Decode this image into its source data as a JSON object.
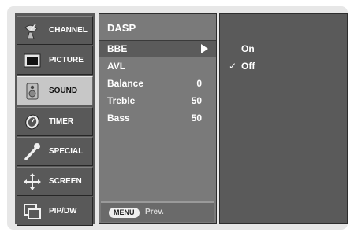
{
  "sidebar": {
    "items": [
      {
        "label": "CHANNEL",
        "icon": "satellite-dish-icon",
        "active": false
      },
      {
        "label": "PICTURE",
        "icon": "tv-screen-icon",
        "active": false
      },
      {
        "label": "SOUND",
        "icon": "speaker-icon",
        "active": true
      },
      {
        "label": "TIMER",
        "icon": "clock-icon",
        "active": false
      },
      {
        "label": "SPECIAL",
        "icon": "wrench-icon",
        "active": false
      },
      {
        "label": "SCREEN",
        "icon": "move-arrows-icon",
        "active": false
      },
      {
        "label": "PIP/DW",
        "icon": "pip-window-icon",
        "active": false
      }
    ]
  },
  "menu": {
    "title": "DASP",
    "rows": [
      {
        "label": "BBE",
        "value": "",
        "selected": true
      },
      {
        "label": "AVL",
        "value": "",
        "selected": false
      },
      {
        "label": "Balance",
        "value": "0",
        "selected": false
      },
      {
        "label": "Treble",
        "value": "50",
        "selected": false
      },
      {
        "label": "Bass",
        "value": "50",
        "selected": false
      }
    ],
    "footer": {
      "button": "MENU",
      "text": "Prev."
    }
  },
  "submenu": {
    "options": [
      {
        "label": "On",
        "check": ""
      },
      {
        "label": "Off",
        "check": "✓"
      }
    ]
  }
}
